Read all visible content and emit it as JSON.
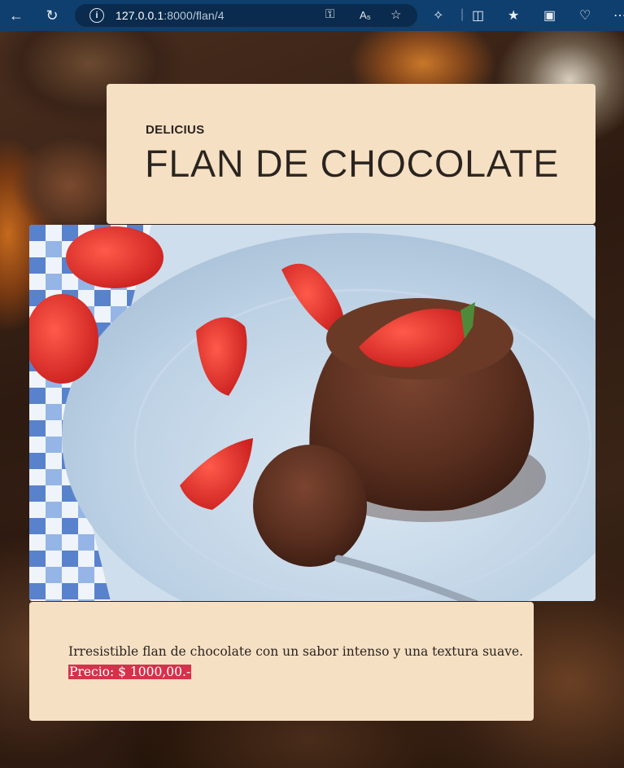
{
  "browser": {
    "url_host": "127.0.0.1",
    "url_path": ":8000/flan/4",
    "back_icon": "arrow-left-icon",
    "refresh_icon": "refresh-icon"
  },
  "card": {
    "kicker": "DELICIUS",
    "title": "FLAN DE CHOCOLATE"
  },
  "photo": {
    "alt": "flan de chocolate con fresas"
  },
  "details": {
    "description": "Irresistible flan de chocolate con un sabor intenso y una textura suave.",
    "price": "Precio: $ 1000,00.-"
  },
  "colors": {
    "card_bg": "#f6e0c3",
    "price_highlight": "#d4324a",
    "chrome_bg": "#0f3f6e"
  }
}
